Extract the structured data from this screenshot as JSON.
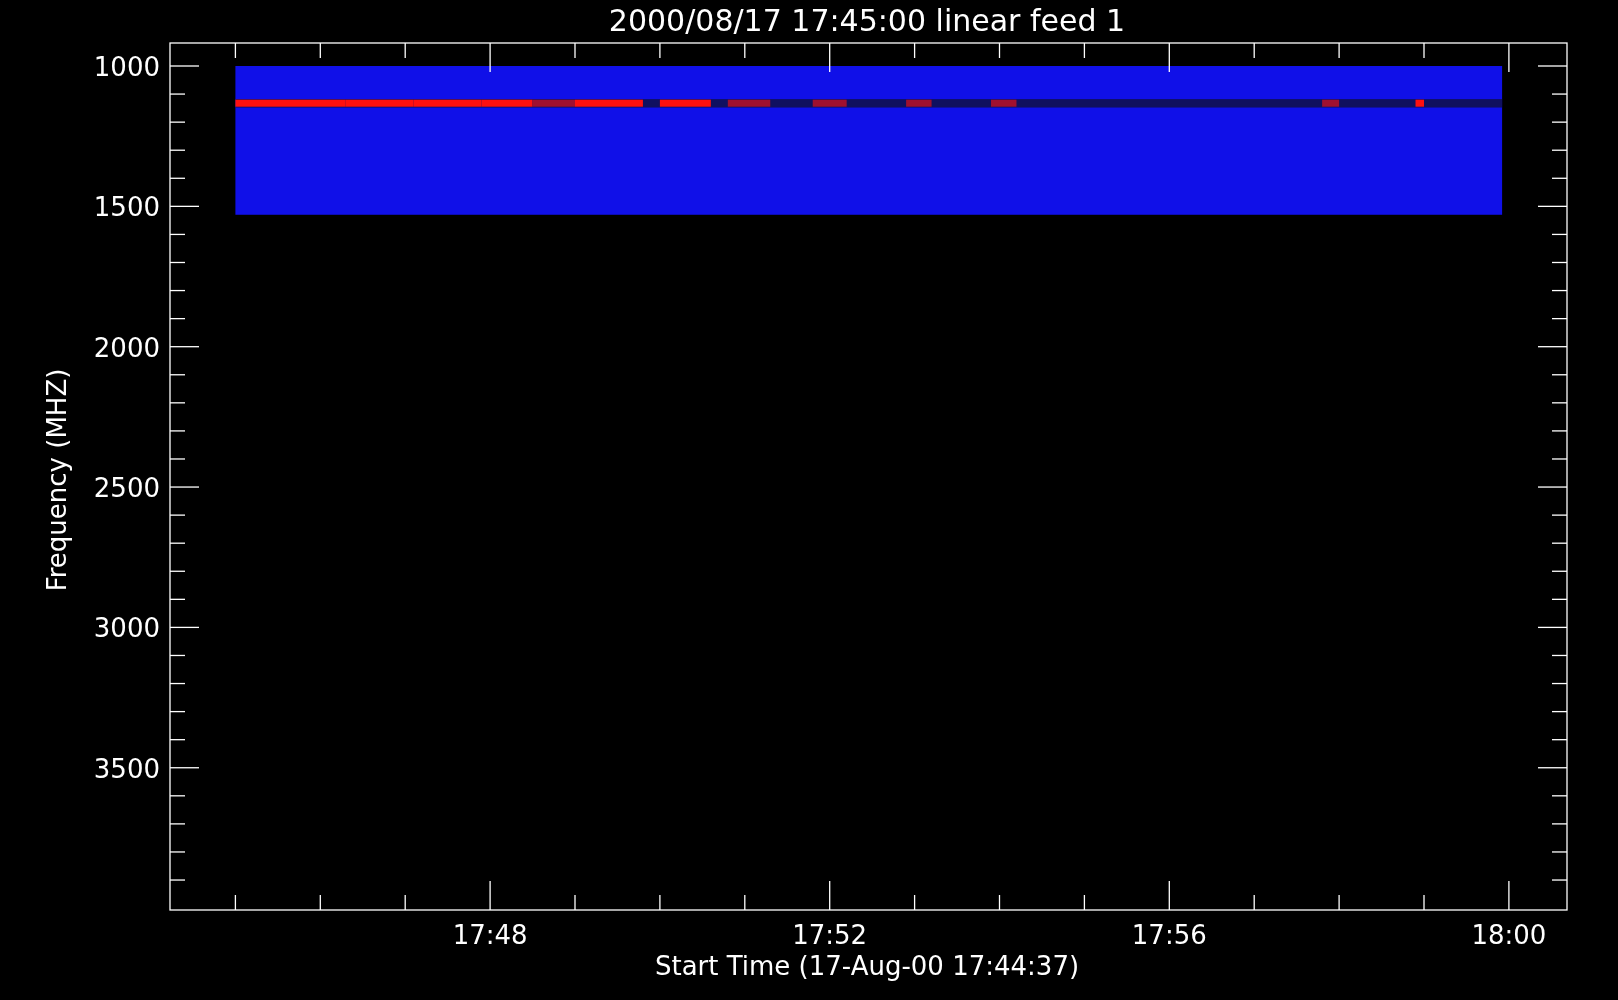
{
  "plot": {
    "title": "2000/08/17 17:45:00 linear feed 1",
    "xlabel": "Start Time (17-Aug-00 17:44:37)",
    "ylabel": "Frequency (MHZ)",
    "xticks": [
      "17:48",
      "17:52",
      "17:56",
      "18:00"
    ],
    "yticks": [
      "1000",
      "1500",
      "2000",
      "2500",
      "3000",
      "3500"
    ]
  }
}
